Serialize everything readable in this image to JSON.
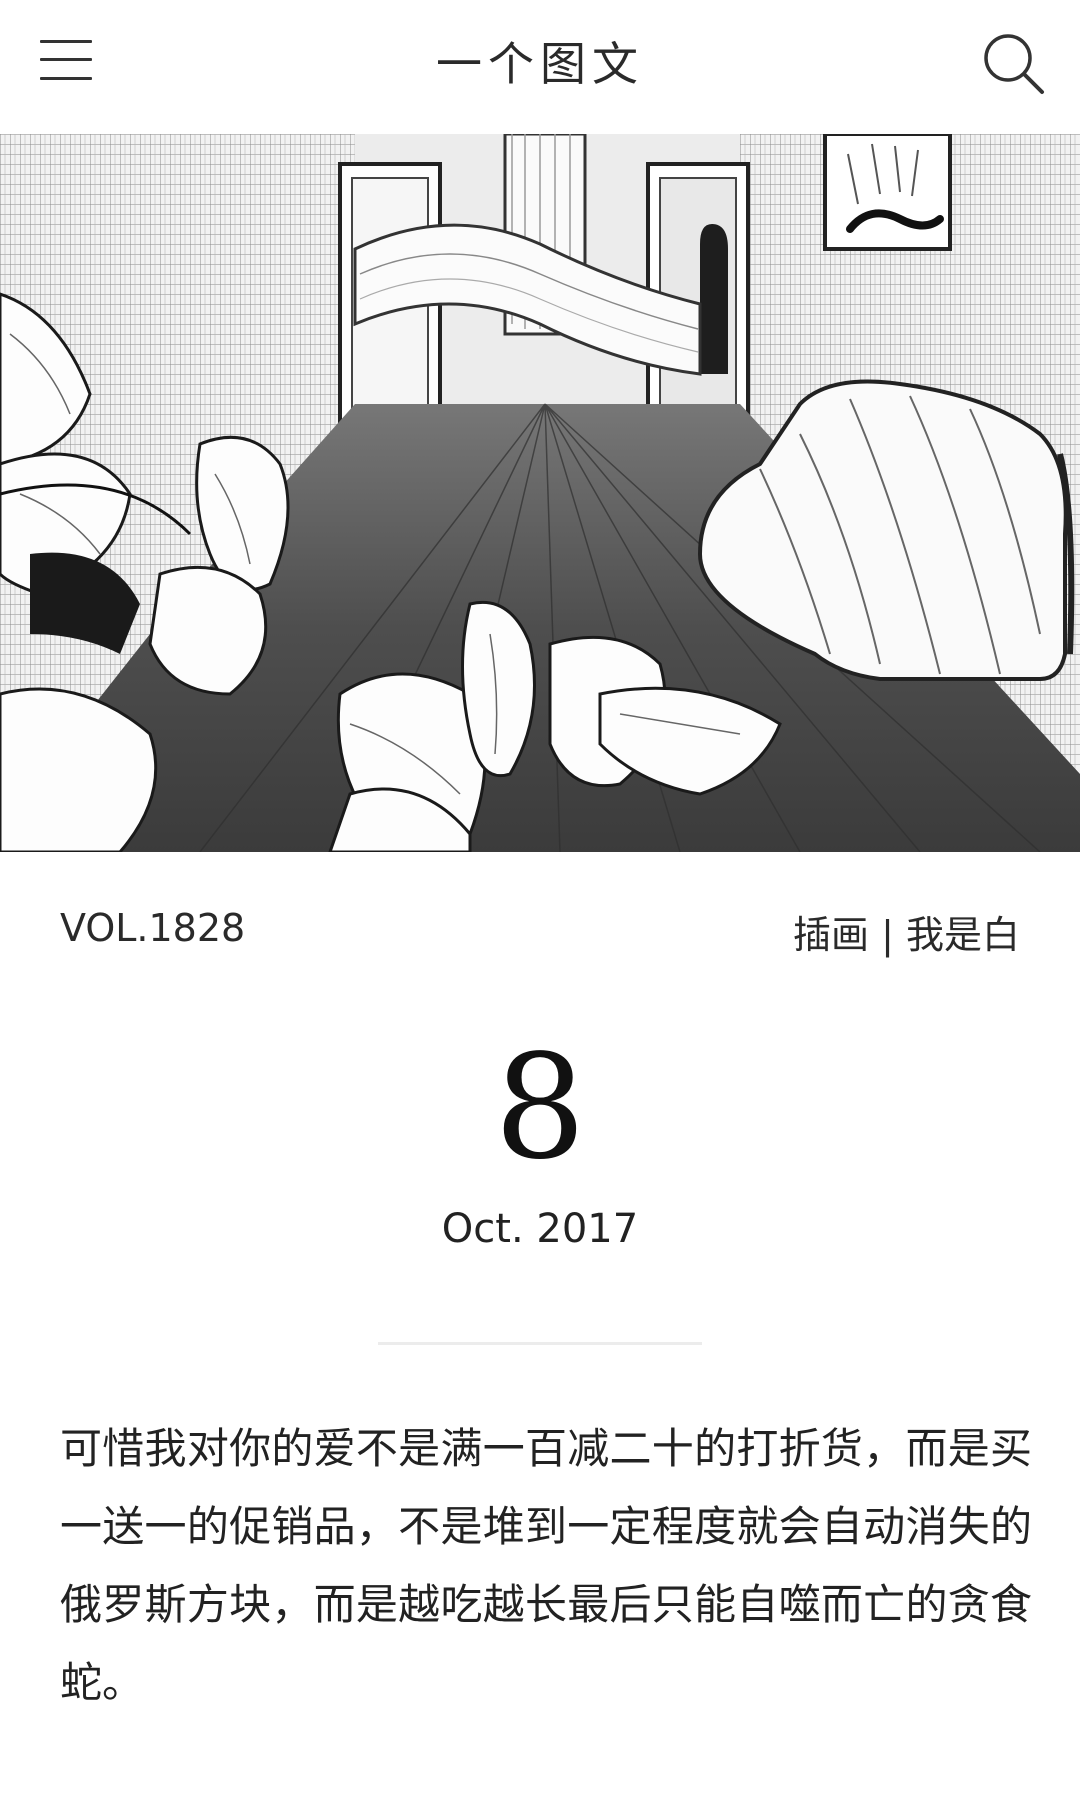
{
  "header": {
    "title": "一个图文",
    "menu_icon": "hamburger-menu-icon",
    "search_icon": "search-icon"
  },
  "article": {
    "volume": "VOL.1828",
    "credit": "插画 | 我是白",
    "day": "8",
    "month_year": "Oct. 2017",
    "quote": "可惜我对你的爱不是满一百减二十的打折货，而是买一送一的促销品，不是堆到一定程度就会自动消失的俄罗斯方块，而是越吃越长最后只能自噬而亡的贪食蛇。"
  }
}
